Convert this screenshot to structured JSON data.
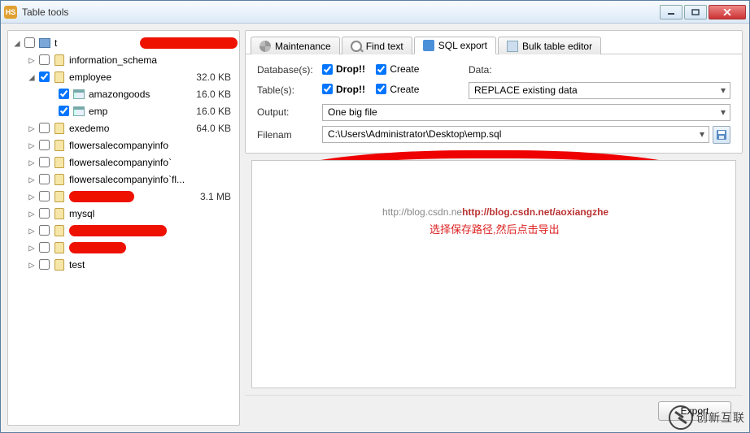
{
  "window": {
    "title": "Table tools",
    "app_icon_text": "HS"
  },
  "tree": {
    "server_label": "t",
    "items": [
      {
        "label": "information_schema",
        "size": "",
        "level": "ind2",
        "exp": "▷",
        "checked": false
      },
      {
        "label": "employee",
        "size": "32.0 KB",
        "level": "ind2",
        "exp": "◢",
        "checked": true
      },
      {
        "label": "amazongoods",
        "size": "16.0 KB",
        "level": "ind3",
        "exp": "",
        "checked": true,
        "table": true
      },
      {
        "label": "emp",
        "size": "16.0 KB",
        "level": "ind3",
        "exp": "",
        "checked": true,
        "table": true
      },
      {
        "label": "exedemo",
        "size": "64.0 KB",
        "level": "ind2",
        "exp": "▷",
        "checked": false
      },
      {
        "label": "flowersalecompanyinfo",
        "size": "",
        "level": "ind2",
        "exp": "▷",
        "checked": false
      },
      {
        "label": "flowersalecompanyinfo`",
        "size": "",
        "level": "ind2",
        "exp": "▷",
        "checked": false
      },
      {
        "label": "flowersalecompanyinfo`fl...",
        "size": "",
        "level": "ind2",
        "exp": "▷",
        "checked": false
      },
      {
        "label": "",
        "size": "3.1 MB",
        "level": "ind2",
        "exp": "▷",
        "checked": false,
        "redact": "w80"
      },
      {
        "label": "mysql",
        "size": "",
        "level": "ind2",
        "exp": "▷",
        "checked": false
      },
      {
        "label": "",
        "size": "",
        "level": "ind2",
        "exp": "▷",
        "checked": false,
        "redact": "w120"
      },
      {
        "label": "",
        "size": "",
        "level": "ind2",
        "exp": "▷",
        "checked": false,
        "redact": "w70"
      },
      {
        "label": "test",
        "size": "",
        "level": "ind2",
        "exp": "▷",
        "checked": false
      }
    ]
  },
  "tabs": {
    "maintenance": "Maintenance",
    "find": "Find text",
    "sql": "SQL export",
    "bulk": "Bulk table editor",
    "active": "sql"
  },
  "form": {
    "databases_label": "Database(s):",
    "tables_label": "Table(s):",
    "output_label": "Output:",
    "filename_label": "Filenam",
    "data_label": "Data:",
    "drop_label": "Drop!!",
    "create_label": "Create",
    "db_drop": true,
    "db_create": true,
    "tbl_drop": true,
    "tbl_create": true,
    "data_select": "REPLACE existing data",
    "output_select": "One big file",
    "filename_value": "C:\\Users\\Administrator\\Desktop\\emp.sql"
  },
  "output": {
    "watermark_prefix": "http://blog.csdn.ne",
    "watermark_url": "http://blog.csdn.net/aoxiangzhe",
    "annotation": "选择保存路径,然后点击导出"
  },
  "footer": {
    "export": "Export"
  },
  "brand": {
    "text": "创新互联"
  }
}
